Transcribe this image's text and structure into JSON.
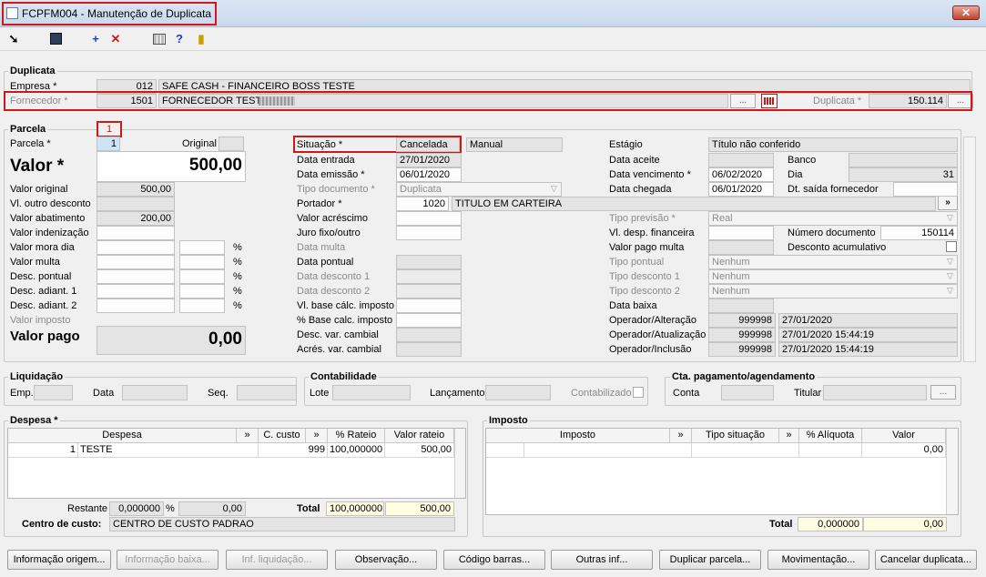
{
  "window": {
    "title": "FCPFM004 - Manutenção de Duplicata",
    "close": "✕"
  },
  "toolbar": {
    "exit_icon": "exit-icon",
    "save_icon": "save-icon",
    "add_icon": "add-icon",
    "delete_icon": "delete-icon",
    "calc_icon": "calculator-icon",
    "help_icon": "help-icon",
    "door_icon": "door-icon"
  },
  "duplicata": {
    "title": "Duplicata",
    "empresa_label": "Empresa *",
    "empresa_code": "012",
    "empresa_name": "SAFE CASH - FINANCEIRO BOSS TESTE",
    "fornecedor_label": "Fornecedor *",
    "fornecedor_code": "1501",
    "fornecedor_name": "FORNECEDOR TESTE",
    "duplicata_label": "Duplicata *",
    "duplicata_value": "150.114",
    "search_btn": "..."
  },
  "parcela": {
    "title": "Parcela",
    "tab_number": "1",
    "parcela_label": "Parcela *",
    "parcela_value": "1",
    "original_label": "Original",
    "valor_label": "Valor *",
    "valor_value": "500,00",
    "valor_original_label": "Valor original",
    "valor_original": "500,00",
    "vl_outro_desc_label": "Vl. outro desconto",
    "valor_abatimento_label": "Valor abatimento",
    "valor_abatimento": "200,00",
    "valor_indenizacao_label": "Valor indenização",
    "valor_mora_label": "Valor mora dia",
    "valor_multa_label": "Valor multa",
    "desc_pontual_label": "Desc. pontual",
    "desc_adiant1_label": "Desc. adiant. 1",
    "desc_adiant2_label": "Desc. adiant. 2",
    "valor_imposto_label": "Valor imposto",
    "valor_pago_label": "Valor pago",
    "valor_pago": "0,00",
    "pct": "%",
    "situacao_label": "Situação *",
    "situacao_value": "Cancelada",
    "situacao_mode": "Manual",
    "data_entrada_label": "Data entrada",
    "data_entrada": "27/01/2020",
    "data_emissao_label": "Data emissão *",
    "data_emissao": "06/01/2020",
    "tipo_doc_label": "Tipo documento *",
    "tipo_doc": "Duplicata",
    "portador_label": "Portador *",
    "portador_code": "1020",
    "portador_name": "TITULO EM CARTEIRA",
    "valor_acrescimo_label": "Valor acréscimo",
    "juro_label": "Juro fixo/outro",
    "data_multa_label": "Data multa",
    "data_pontual_label": "Data pontual",
    "data_desc1_label": "Data desconto 1",
    "data_desc2_label": "Data desconto 2",
    "vl_base_label": "Vl. base cálc. imposto",
    "pct_base_label": "% Base calc. imposto",
    "desc_cambial_label": "Desc. var. cambial",
    "acres_cambial_label": "Acrés. var. cambial",
    "estagio_label": "Estágio",
    "estagio": "Título não conferido",
    "data_aceite_label": "Data aceite",
    "banco_label": "Banco",
    "data_venc_label": "Data vencimento *",
    "data_venc": "06/02/2020",
    "dia_label": "Dia",
    "dia": "31",
    "data_chegada_label": "Data chegada",
    "data_chegada": "06/01/2020",
    "dt_saida_label": "Dt. saída fornecedor",
    "tipo_previsao_label": "Tipo previsão *",
    "tipo_previsao": "Real",
    "vl_desp_fin_label": "Vl. desp. financeira",
    "numero_doc_label": "Número documento",
    "numero_doc": "150114",
    "valor_pago_multa_label": "Valor pago multa",
    "desc_acum_label": "Desconto acumulativo",
    "tipo_pontual_label": "Tipo pontual",
    "tipo_pontual": "Nenhum",
    "tipo_desc1_label": "Tipo desconto 1",
    "tipo_desc1": "Nenhum",
    "tipo_desc2_label": "Tipo desconto 2",
    "tipo_desc2": "Nenhum",
    "data_baixa_label": "Data baixa",
    "op_alt_label": "Operador/Alteração",
    "op_alt_code": "999998",
    "op_alt_date": "27/01/2020",
    "op_atu_label": "Operador/Atualização",
    "op_atu_code": "999998",
    "op_atu_date": "27/01/2020 15:44:19",
    "op_inc_label": "Operador/Inclusão",
    "op_inc_code": "999998",
    "op_inc_date": "27/01/2020 15:44:19",
    "go": "»"
  },
  "liquidacao": {
    "title": "Liquidação",
    "emp": "Emp.",
    "data": "Data",
    "seq": "Seq."
  },
  "contabilidade": {
    "title": "Contabilidade",
    "lote": "Lote",
    "lancamento": "Lançamento",
    "contabilizado": "Contabilizado"
  },
  "cta": {
    "title": "Cta. pagamento/agendamento",
    "conta": "Conta",
    "titular": "Titular"
  },
  "despesa": {
    "title": "Despesa *",
    "headers": [
      "Despesa",
      "»",
      "C. custo",
      "»",
      "% Rateio",
      "Valor rateio"
    ],
    "row": {
      "code": "1",
      "name": "TESTE",
      "ccusto": "999",
      "rateio": "100,000000",
      "valor": "500,00"
    },
    "restante_label": "Restante",
    "restante_pct": "0,000000",
    "restante_val": "0,00",
    "pct": "%",
    "total_label": "Total",
    "total_pct": "100,000000",
    "total_val": "500,00",
    "ccusto_label": "Centro de custo:",
    "ccusto_value": "CENTRO DE CUSTO PADRAO"
  },
  "imposto": {
    "title": "Imposto",
    "headers": [
      "Imposto",
      "»",
      "Tipo situação",
      "»",
      "% Alíquota",
      "Valor"
    ],
    "row_valor": "0,00",
    "total_label": "Total",
    "total_pct": "0,000000",
    "total_val": "0,00"
  },
  "buttons": [
    "Informação origem...",
    "Informação baixa...",
    "Inf. liquidação...",
    "Observação...",
    "Código barras...",
    "Outras inf...",
    "Duplicar parcela...",
    "Movimentação...",
    "Cancelar duplicata..."
  ],
  "colors": {
    "highlight": "#d01818",
    "disabled_field": "#e4e4e4",
    "total_field": "#fffde2"
  }
}
